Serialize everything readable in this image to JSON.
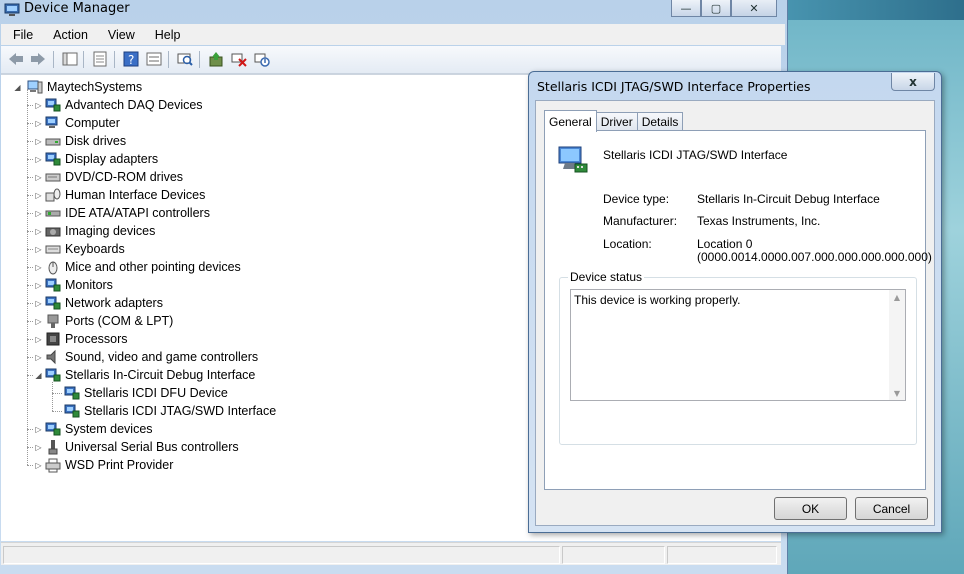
{
  "device_manager": {
    "title": "Device Manager",
    "window_buttons": {
      "minimize": "—",
      "maximize": "▢",
      "close": "✕"
    },
    "menu": [
      "File",
      "Action",
      "View",
      "Help"
    ],
    "tree": {
      "root": "MaytechSystems",
      "categories": [
        {
          "label": "Advantech DAQ Devices",
          "icon": "daq-device-icon"
        },
        {
          "label": "Computer",
          "icon": "computer-icon"
        },
        {
          "label": "Disk drives",
          "icon": "disk-drive-icon"
        },
        {
          "label": "Display adapters",
          "icon": "display-adapter-icon"
        },
        {
          "label": "DVD/CD-ROM drives",
          "icon": "dvd-drive-icon"
        },
        {
          "label": "Human Interface Devices",
          "icon": "hid-icon"
        },
        {
          "label": "IDE ATA/ATAPI controllers",
          "icon": "ide-controller-icon"
        },
        {
          "label": "Imaging devices",
          "icon": "imaging-device-icon"
        },
        {
          "label": "Keyboards",
          "icon": "keyboard-icon"
        },
        {
          "label": "Mice and other pointing devices",
          "icon": "mouse-icon"
        },
        {
          "label": "Monitors",
          "icon": "monitor-icon"
        },
        {
          "label": "Network adapters",
          "icon": "network-adapter-icon"
        },
        {
          "label": "Ports (COM & LPT)",
          "icon": "port-icon"
        },
        {
          "label": "Processors",
          "icon": "processor-icon"
        },
        {
          "label": "Sound, video and game controllers",
          "icon": "sound-icon"
        },
        {
          "label": "Stellaris In-Circuit Debug Interface",
          "icon": "debug-interface-icon",
          "expanded": true,
          "children": [
            "Stellaris ICDI DFU Device",
            "Stellaris ICDI JTAG/SWD Interface"
          ]
        },
        {
          "label": "System devices",
          "icon": "system-device-icon"
        },
        {
          "label": "Universal Serial Bus controllers",
          "icon": "usb-icon"
        },
        {
          "label": "WSD Print Provider",
          "icon": "printer-icon"
        }
      ]
    }
  },
  "properties_dialog": {
    "title": "Stellaris ICDI JTAG/SWD Interface Properties",
    "close_label": "x",
    "tabs": [
      "General",
      "Driver",
      "Details"
    ],
    "active_tab": "General",
    "device_name": "Stellaris ICDI JTAG/SWD Interface",
    "device_type_label": "Device type:",
    "device_type": "Stellaris In-Circuit Debug Interface",
    "manufacturer_label": "Manufacturer:",
    "manufacturer": "Texas Instruments, Inc.",
    "location_label": "Location:",
    "location_line1": "Location 0",
    "location_line2": "(0000.0014.0000.007.000.000.000.000.000)",
    "status_group_label": "Device status",
    "status_text": "This device is working properly.",
    "ok_label": "OK",
    "cancel_label": "Cancel"
  }
}
